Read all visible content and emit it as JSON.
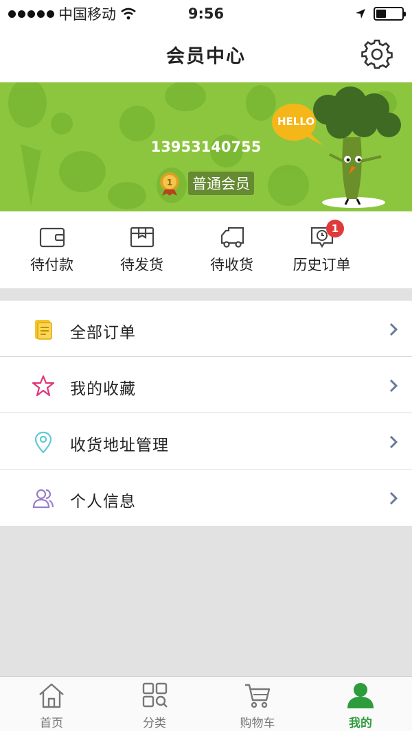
{
  "status_bar": {
    "carrier": "中国移动",
    "time": "9:56"
  },
  "header": {
    "title": "会员中心",
    "settings_icon": "gear-icon"
  },
  "banner": {
    "phone": "13953140755",
    "level": "普通会员",
    "hello": "HELLO",
    "bg_color": "#8cc63e"
  },
  "orders": {
    "items": [
      {
        "label": "待付款",
        "icon": "wallet-icon"
      },
      {
        "label": "待发货",
        "icon": "box-icon"
      },
      {
        "label": "待收货",
        "icon": "truck-icon"
      },
      {
        "label": "历史订单",
        "icon": "clock-icon",
        "badge": "1"
      }
    ]
  },
  "menu": {
    "items": [
      {
        "label": "全部订单",
        "icon": "document-icon",
        "color": "#f0c419"
      },
      {
        "label": "我的收藏",
        "icon": "star-icon",
        "color": "#e0337a"
      },
      {
        "label": "收货地址管理",
        "icon": "location-pin-icon",
        "color": "#5fc8d6"
      },
      {
        "label": "个人信息",
        "icon": "user-group-icon",
        "color": "#9a7cc9"
      }
    ]
  },
  "tabbar": {
    "items": [
      {
        "label": "首页",
        "icon": "home-icon"
      },
      {
        "label": "分类",
        "icon": "category-icon"
      },
      {
        "label": "购物车",
        "icon": "cart-icon"
      },
      {
        "label": "我的",
        "icon": "user-icon",
        "active": true
      }
    ],
    "active_color": "#2e9b3c"
  }
}
